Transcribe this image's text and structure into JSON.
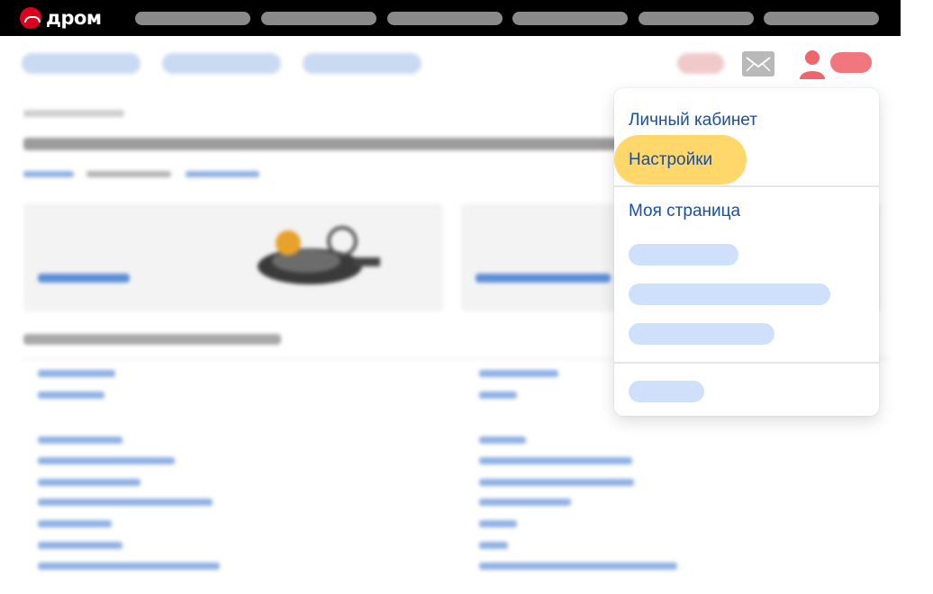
{
  "brand": {
    "logo_text": "дром",
    "accent": "#db001b"
  },
  "menu": {
    "items": [
      {
        "label": "Личный кабинет"
      },
      {
        "label": "Настройки",
        "highlighted": true
      },
      {
        "label": "Моя страница"
      }
    ]
  },
  "icons": {
    "mail": "mail-icon",
    "user": "user-icon"
  }
}
